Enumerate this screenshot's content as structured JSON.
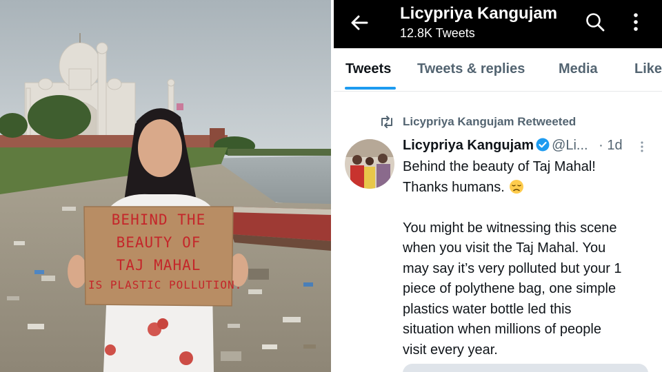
{
  "photo": {
    "sign_lines": [
      "BEHIND THE",
      "BEAUTY OF",
      "TAJ MAHAL",
      "IS PLASTIC POLLUTION."
    ]
  },
  "profile_header": {
    "name": "Licypriya Kangujam",
    "tweet_count": "12.8K Tweets",
    "icons": [
      "back-arrow-icon",
      "search-icon",
      "more-vertical-icon"
    ]
  },
  "tabs": [
    {
      "label": "Tweets",
      "active": true
    },
    {
      "label": "Tweets & replies",
      "active": false
    },
    {
      "label": "Media",
      "active": false
    },
    {
      "label": "Like",
      "active": false
    }
  ],
  "tweet": {
    "retweet_label": "Licypriya Kangujam Retweeted",
    "author_name": "Licypriya Kangujam",
    "handle": "@Li...",
    "time": "· 1d",
    "lines_para1": [
      "Behind the beauty of Taj Mahal!",
      "Thanks humans."
    ],
    "emoji": "disappointed-face",
    "lines_para2": [
      "You might be witnessing this scene",
      "when you visit the Taj Mahal. You",
      "may say it’s very polluted but your 1",
      "piece of polythene bag, one simple",
      "plastics water bottle led this",
      "situation when millions of people",
      "visit every year."
    ]
  },
  "colors": {
    "accent": "#1d9bf0",
    "header_bg": "#000000",
    "muted_text": "#536471",
    "sign_text": "#c4262a"
  }
}
